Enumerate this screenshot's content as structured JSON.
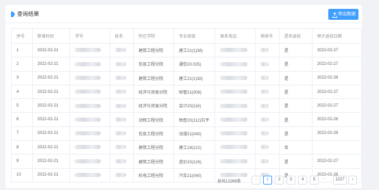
{
  "header": {
    "title": "查询结果",
    "export_label": "导出数据"
  },
  "table": {
    "columns": [
      "序号",
      "新增时间",
      "学号",
      "姓名",
      "所在学院",
      "专业班级",
      "联系电话",
      "宿舍号",
      "是否返校",
      "预计返校日期"
    ],
    "rows": [
      {
        "no": "1",
        "date": "2022-02-21",
        "college": "建筑工程分院",
        "cls": "建工21(1)38)",
        "back": "是",
        "eta": "2022-02-27"
      },
      {
        "no": "2",
        "date": "2022-02-21",
        "college": "信息工程分院",
        "cls": "通信20.025)",
        "back": "是",
        "eta": "2022-02-27"
      },
      {
        "no": "3",
        "date": "2022-02-21",
        "college": "建筑工程分院",
        "cls": "建工21(1)38)",
        "back": "是",
        "eta": "2022-02-26"
      },
      {
        "no": "4",
        "date": "2022-02-21",
        "college": "经济与贸易分院",
        "cls": "财管21(008)",
        "back": "是",
        "eta": "2022-02-27"
      },
      {
        "no": "5",
        "date": "2022-02-21",
        "college": "经济与贸易分院",
        "cls": "会计20(116)",
        "back": "是",
        "eta": "2022-02-27"
      },
      {
        "no": "6",
        "date": "2022-02-21",
        "college": "动物工程分院",
        "cls": "牧医20(112)石平",
        "back": "是",
        "eta": "2022-02-26"
      },
      {
        "no": "7",
        "date": "2022-02-21",
        "college": "信息工程分院",
        "cls": "动漫21(040)",
        "back": "是",
        "eta": "2022-02-26"
      },
      {
        "no": "8",
        "date": "2022-02-21",
        "college": "建筑工程分院",
        "cls": "建工19(122)",
        "back": "否",
        "eta": ""
      },
      {
        "no": "9",
        "date": "2022-02-21",
        "college": "建筑工程分院",
        "cls": "造价20(126)",
        "back": "是",
        "eta": "2022-02-27"
      },
      {
        "no": "10",
        "date": "2022-02-21",
        "college": "机电工程分院",
        "cls": "汽车21(040)",
        "back": "是",
        "eta": "2022-02-26"
      }
    ]
  },
  "pagination": {
    "total_text": "总共12269条",
    "prev": "‹",
    "pages": [
      "1",
      "2",
      "3",
      "4",
      "5"
    ],
    "ellipsis": "···",
    "last": "1227",
    "next": "›",
    "current": "1"
  },
  "colors": {
    "accent": "#409eff",
    "border": "#ebeef5"
  },
  "icons": {
    "title": "bookmark-arrow-icon",
    "export": "upload-icon"
  }
}
